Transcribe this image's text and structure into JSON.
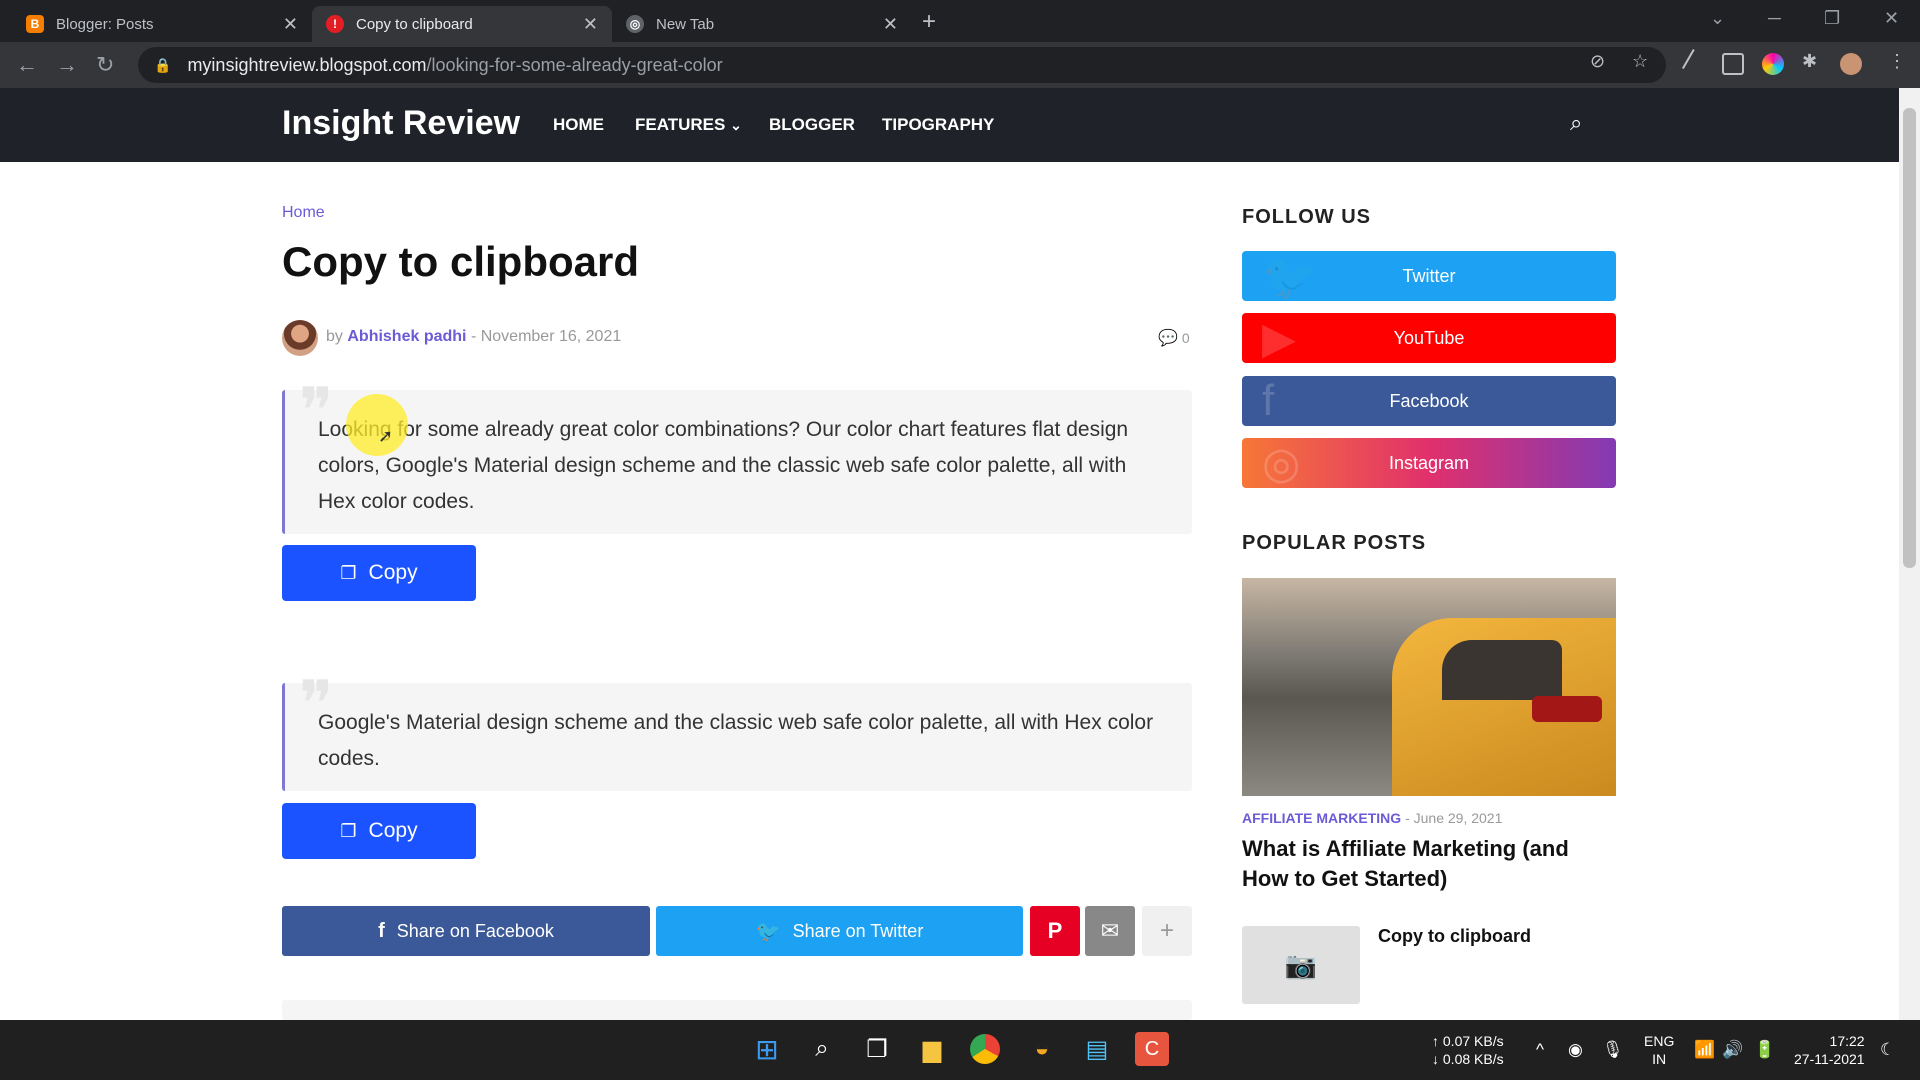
{
  "browser": {
    "tabs": [
      {
        "title": "Blogger: Posts",
        "favicon_color": "#f57d00",
        "favicon_glyph": "B",
        "active": false
      },
      {
        "title": "Copy to clipboard",
        "favicon_color": "#e31e24",
        "favicon_glyph": "!",
        "active": true
      },
      {
        "title": "New Tab",
        "favicon_color": "#5f6368",
        "favicon_glyph": "◎",
        "active": false
      }
    ],
    "url_host": "myinsightreview.blogspot.com",
    "url_path": "/looking-for-some-already-great-color"
  },
  "site": {
    "logo": "Insight Review",
    "nav": [
      "HOME",
      "FEATURES",
      "BLOGGER",
      "TIPOGRAPHY"
    ],
    "features_chevron": "⌄"
  },
  "post": {
    "breadcrumb": "Home",
    "title": "Copy to clipboard",
    "by": "by",
    "author": "Abhishek padhi",
    "separator": "-",
    "date": "November 16, 2021",
    "comment_count": "0",
    "quotes": [
      {
        "text": "Looking for some already great color combinations? Our color chart features flat design colors, Google's Material design scheme and the classic web safe color palette, all with Hex color codes.",
        "button": "Copy"
      },
      {
        "text": "Google's Material design scheme and the classic web safe color palette, all with Hex color codes.",
        "button": "Copy"
      }
    ],
    "share": {
      "facebook": "Share on Facebook",
      "twitter": "Share on Twitter"
    }
  },
  "sidebar": {
    "follow_heading": "FOLLOW US",
    "social": [
      {
        "label": "Twitter",
        "color": "#1da1f2"
      },
      {
        "label": "YouTube",
        "color": "#ff0000"
      },
      {
        "label": "Facebook",
        "color": "#3b5998"
      },
      {
        "label": "Instagram",
        "color": "#e1306c"
      }
    ],
    "popular_heading": "POPULAR POSTS",
    "popular_post": {
      "category": "AFFILIATE MARKETING",
      "separator": "-",
      "date": "June 29, 2021",
      "title": "What is Affiliate Marketing (and How to Get Started)"
    },
    "related_title": "Copy to clipboard"
  },
  "taskbar": {
    "net_up": "↑ 0.07 KB/s",
    "net_down": "↓ 0.08 KB/s",
    "lang_1": "ENG",
    "lang_2": "IN",
    "time": "17:22",
    "date": "27-11-2021"
  },
  "colors": {
    "accent": "#6b5bd6",
    "copy_button": "#1a53ff",
    "header_bg": "#1f2329",
    "share_facebook": "#3b5998",
    "share_twitter": "#1da1f2",
    "share_pinterest": "#e60023",
    "share_email": "#888888"
  }
}
